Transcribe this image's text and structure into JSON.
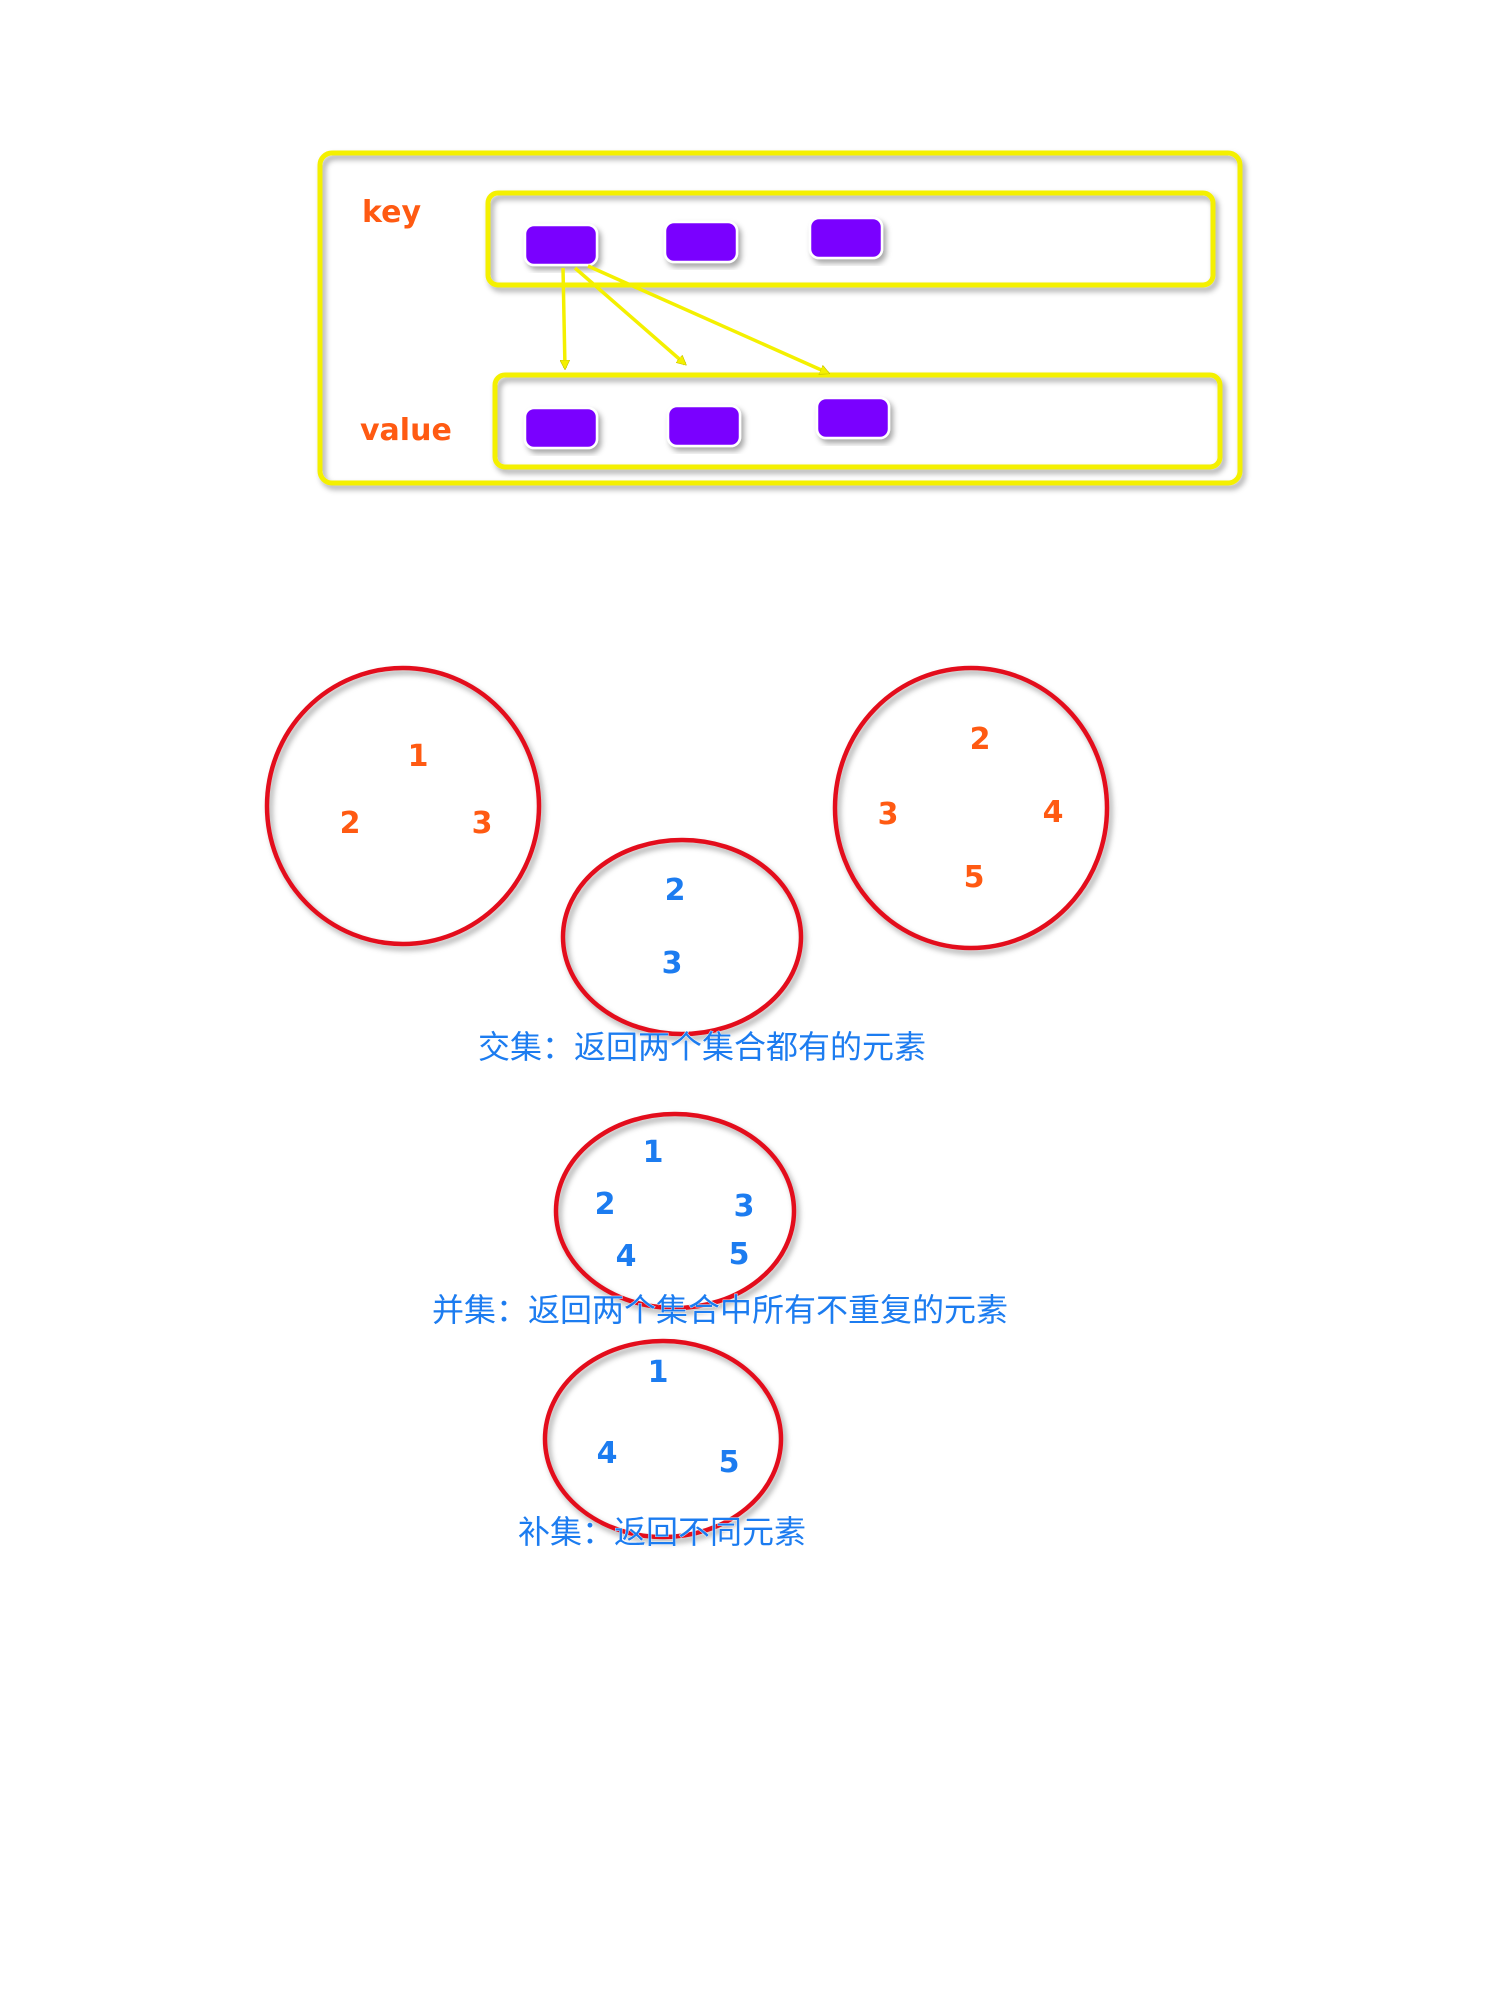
{
  "colors": {
    "frame_yellow": "#f4f000",
    "box_purple": "#7a00ff",
    "circle_red": "#e3101c",
    "text_orange": "#ff5a12",
    "text_blue": "#1c7cf0"
  },
  "hash_diagram": {
    "key_label": "key",
    "value_label": "value"
  },
  "set_a": {
    "elements": [
      "1",
      "2",
      "3"
    ]
  },
  "set_b": {
    "elements": [
      "2",
      "3",
      "4",
      "5"
    ]
  },
  "intersection": {
    "elements": [
      "2",
      "3"
    ],
    "caption": "交集：返回两个集合都有的元素"
  },
  "union": {
    "elements": [
      "1",
      "2",
      "3",
      "4",
      "5"
    ],
    "caption": "并集：返回两个集合中所有不重复的元素"
  },
  "difference": {
    "elements": [
      "1",
      "4",
      "5"
    ],
    "caption": "补集：返回不同元素"
  }
}
